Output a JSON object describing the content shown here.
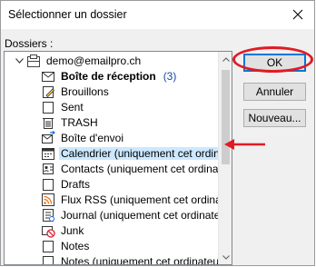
{
  "window": {
    "title": "Sélectionner un dossier"
  },
  "section_label": "Dossiers :",
  "tree": {
    "account": "demo@emailpro.ch",
    "items": [
      {
        "label": "Boîte de réception",
        "count": "(3)",
        "bold": true,
        "icon": "inbox-icon"
      },
      {
        "label": "Brouillons",
        "icon": "drafts-icon"
      },
      {
        "label": "Sent",
        "icon": "folder-icon"
      },
      {
        "label": "TRASH",
        "icon": "trash-icon"
      },
      {
        "label": "Boîte d'envoi",
        "icon": "outbox-icon"
      },
      {
        "label": "Calendrier (uniquement cet ordinateur)",
        "icon": "calendar-icon",
        "selected": true
      },
      {
        "label": "Contacts (uniquement cet ordinateur)",
        "icon": "contacts-icon"
      },
      {
        "label": "Drafts",
        "icon": "folder-icon"
      },
      {
        "label": "Flux RSS (uniquement cet ordinateur)",
        "icon": "rss-icon"
      },
      {
        "label": "Journal (uniquement cet ordinateur)",
        "icon": "journal-icon"
      },
      {
        "label": "Junk",
        "icon": "junk-icon"
      },
      {
        "label": "Notes",
        "icon": "notes-icon"
      },
      {
        "label": "Notes (uniquement cet ordinateur)",
        "icon": "notes-icon"
      }
    ]
  },
  "buttons": {
    "ok": "OK",
    "new_folder": "Annuler",
    "new": "Nouveau..."
  },
  "colors": {
    "annotation": "#e01b24",
    "selection": "#cce8ff",
    "default_button_border": "#0078d7"
  }
}
